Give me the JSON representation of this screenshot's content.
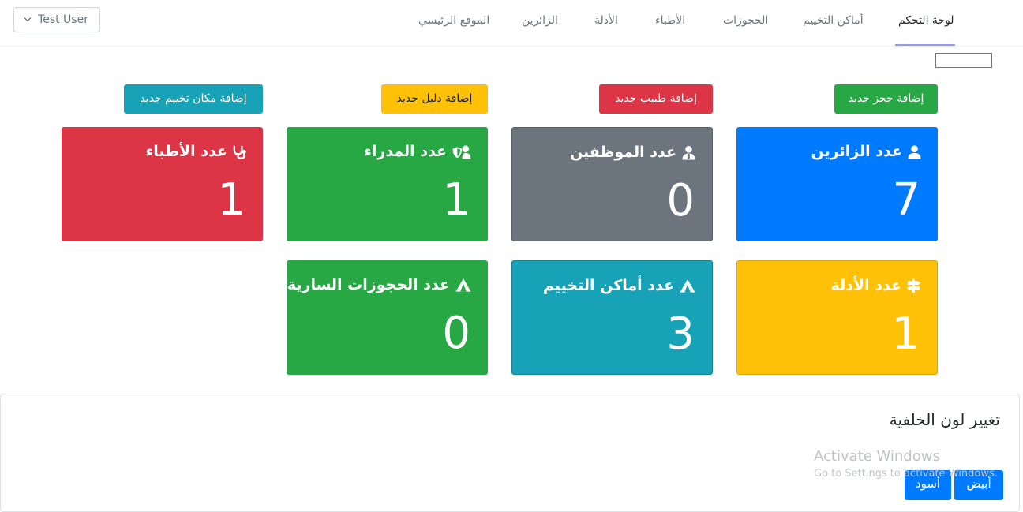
{
  "nav": {
    "items": [
      {
        "label": "لوحة التحكم",
        "active": true
      },
      {
        "label": "أماكن التخييم"
      },
      {
        "label": "الحجوزات"
      },
      {
        "label": "الأطباء"
      },
      {
        "label": "الأدلة"
      },
      {
        "label": "الزائرين"
      },
      {
        "label": "الموقع الرئيسي"
      }
    ],
    "user_label": "Test User"
  },
  "actions": {
    "add_booking": "إضافة حجز جديد",
    "add_doctor": "إضافة طبيب جديد",
    "add_guide": "إضافة دليل جديد",
    "add_camp": "إضافة مكان تخييم جديد"
  },
  "cards": {
    "visitors": {
      "label": "عدد الزائرين",
      "value": "7",
      "icon": "user-icon",
      "color": "#007bff"
    },
    "employees": {
      "label": "عدد الموظفين",
      "value": "0",
      "icon": "user-tie-icon",
      "color": "#6c757d"
    },
    "managers": {
      "label": "عدد المدراء",
      "value": "1",
      "icon": "user-shield-icon",
      "color": "#28a745"
    },
    "doctors": {
      "label": "عدد الأطباء",
      "value": "1",
      "icon": "stethoscope-icon",
      "color": "#dc3545"
    },
    "guides": {
      "label": "عدد الأدلة",
      "value": "1",
      "icon": "signs-icon",
      "color": "#ffc107"
    },
    "camps": {
      "label": "عدد أماكن التخييم",
      "value": "3",
      "icon": "tent-icon",
      "color": "#17a2b8"
    },
    "active_bookings": {
      "label": "عدد الحجوزات السارية",
      "value": "0",
      "icon": "tent-icon",
      "color": "#28a745"
    }
  },
  "background_panel": {
    "title": "تغيير لون الخلفية",
    "white_label": "أبيض",
    "black_label": "أسود"
  },
  "watermark": {
    "line1": "Activate Windows",
    "line2": "Go to Settings to activate Windows."
  }
}
